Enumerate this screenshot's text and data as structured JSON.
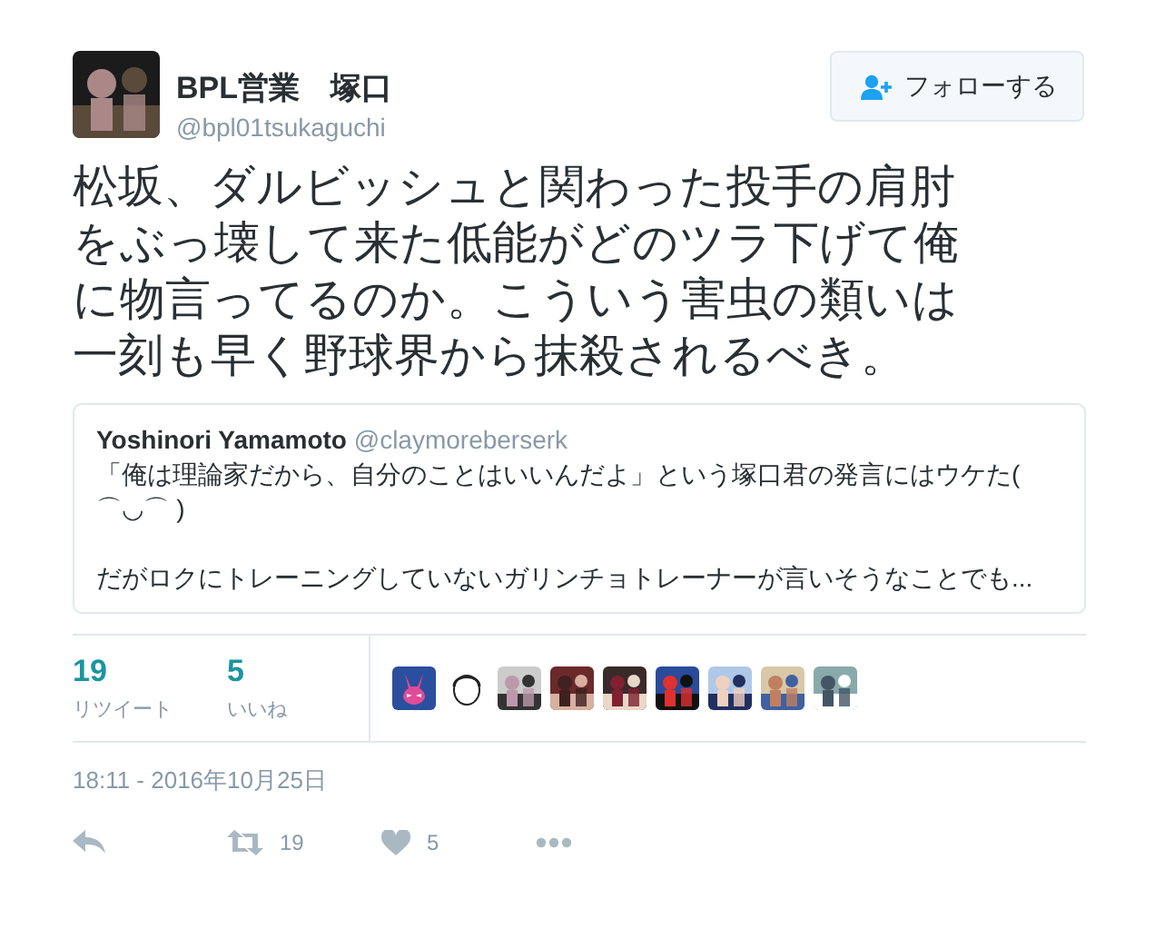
{
  "author": {
    "name": "BPL営業　塚口",
    "handle": "@bpl01tsukaguchi",
    "avatar": {
      "kind": "picture"
    }
  },
  "follow_button": {
    "label": "フォローする"
  },
  "text": "松坂、ダルビッシュと関わった投手の肩肘をぶっ壊して来た低能がどのツラ下げて俺に物言ってるのか。こういう害虫の類いは一刻も早く野球界から抹殺されるべき。",
  "quote": {
    "name": "Yoshinori Yamamoto",
    "handle": "@claymoreberserk",
    "paragraphs": [
      "「俺は理論家だから、自分のことはいいんだよ」という塚口君の発言にはウケた(\n⌒◡⌒ )",
      "だがロクにトレーニングしていないガリンチョトレーナーが言いそうなことでも..."
    ]
  },
  "stats": [
    {
      "count": "19",
      "label": "リツイート"
    },
    {
      "count": "5",
      "label": "いいね"
    }
  ],
  "likers": [
    {
      "kind": "bunny"
    },
    {
      "kind": "sketch"
    },
    {
      "kind": "picture"
    },
    {
      "kind": "picture"
    },
    {
      "kind": "picture"
    },
    {
      "kind": "picture"
    },
    {
      "kind": "picture"
    },
    {
      "kind": "picture"
    },
    {
      "kind": "picture"
    }
  ],
  "timestamp": "18:11 - 2016年10月25日",
  "actions": [
    {
      "kind": "reply"
    },
    {
      "kind": "retweet",
      "count": "19"
    },
    {
      "kind": "like",
      "count": "5"
    },
    {
      "kind": "more"
    }
  ]
}
